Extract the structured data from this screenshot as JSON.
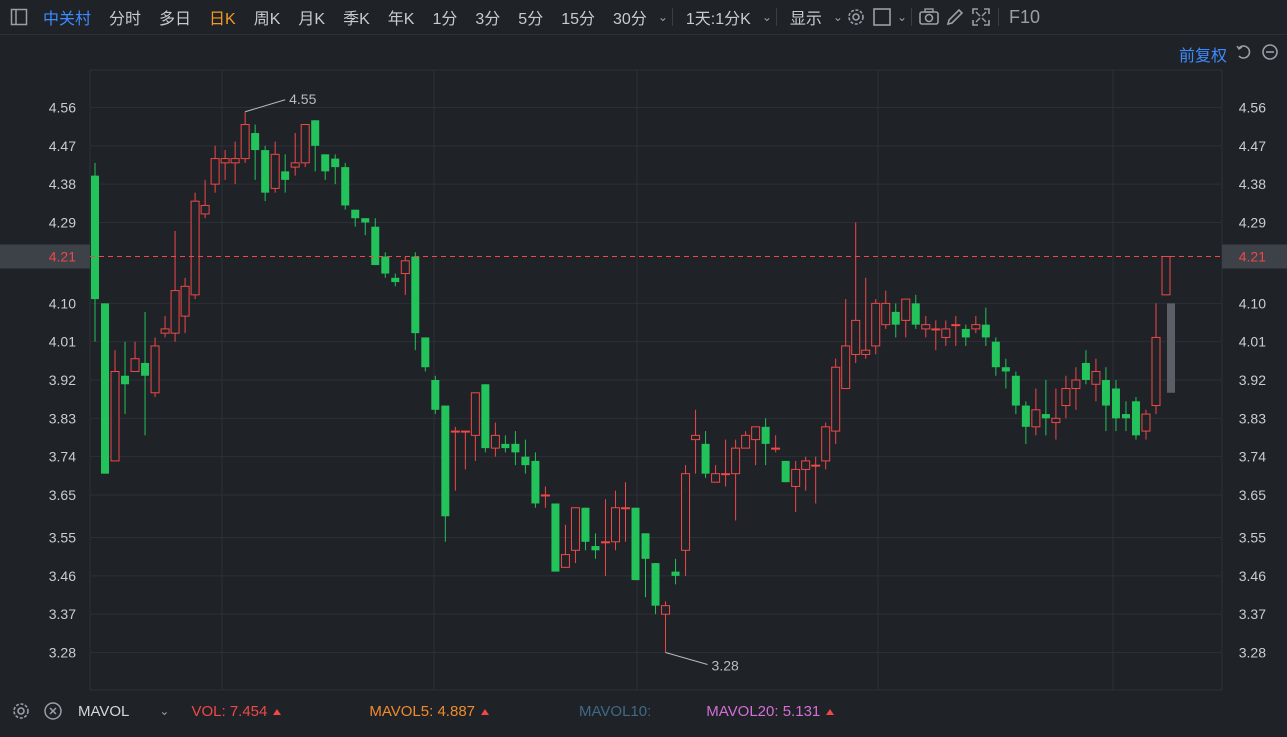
{
  "toolbar": {
    "stock_name": "中关村",
    "periods": [
      "分时",
      "多日",
      "日K",
      "周K",
      "月K",
      "季K",
      "年K",
      "1分",
      "3分",
      "5分",
      "15分",
      "30分"
    ],
    "active_period": "日K",
    "range_select": "1天:1分K",
    "display_label": "显示",
    "f10_label": "F10"
  },
  "adjust_label": "前复权",
  "price_axis": {
    "ticks": [
      "4.56",
      "4.47",
      "4.38",
      "4.29",
      "4.10",
      "4.01",
      "3.92",
      "3.83",
      "3.74",
      "3.65",
      "3.55",
      "3.46",
      "3.37",
      "3.28"
    ],
    "current": "4.21"
  },
  "markers": {
    "high": "4.55",
    "low": "3.28"
  },
  "indicator_bar": {
    "name": "MAVOL",
    "vol_label": "VOL:",
    "vol_value": "7.454",
    "mavol5_label": "MAVOL5:",
    "mavol5_value": "4.887",
    "mavol10_label": "MAVOL10:",
    "mavol20_label": "MAVOL20:",
    "mavol20_value": "5.131"
  },
  "colors": {
    "up": "#f04848",
    "down": "#22c35a",
    "grid": "#2c3036",
    "bg": "#1f2227",
    "vol": "#f04848",
    "mavol5": "#f08a2c",
    "mavol10": "#3f6a86",
    "mavol20": "#d36fd6",
    "accent": "#3d8bff"
  },
  "chart_data": {
    "type": "candlestick",
    "ylim": [
      3.26,
      4.58
    ],
    "current_price": 4.21,
    "high_mark": 4.55,
    "low_mark": 3.28,
    "candles": [
      [
        4.4,
        4.11,
        4.43,
        4.01
      ],
      [
        4.1,
        3.7,
        4.1,
        3.7
      ],
      [
        3.73,
        3.94,
        3.99,
        3.73
      ],
      [
        3.93,
        3.91,
        4.01,
        3.84
      ],
      [
        3.94,
        3.97,
        4.01,
        3.94
      ],
      [
        3.96,
        3.93,
        4.08,
        3.79
      ],
      [
        3.89,
        4.0,
        4.02,
        3.88
      ],
      [
        4.03,
        4.04,
        4.07,
        4.02
      ],
      [
        4.03,
        4.13,
        4.27,
        4.01
      ],
      [
        4.07,
        4.14,
        4.16,
        4.03
      ],
      [
        4.12,
        4.34,
        4.36,
        4.11
      ],
      [
        4.31,
        4.33,
        4.39,
        4.3
      ],
      [
        4.38,
        4.44,
        4.47,
        4.36
      ],
      [
        4.43,
        4.44,
        4.46,
        4.39
      ],
      [
        4.43,
        4.44,
        4.48,
        4.38
      ],
      [
        4.44,
        4.52,
        4.55,
        4.43
      ],
      [
        4.5,
        4.46,
        4.52,
        4.39
      ],
      [
        4.46,
        4.36,
        4.47,
        4.34
      ],
      [
        4.37,
        4.45,
        4.48,
        4.36
      ],
      [
        4.41,
        4.39,
        4.45,
        4.36
      ],
      [
        4.42,
        4.43,
        4.5,
        4.4
      ],
      [
        4.43,
        4.52,
        4.52,
        4.42
      ],
      [
        4.53,
        4.47,
        4.53,
        4.41
      ],
      [
        4.45,
        4.41,
        4.45,
        4.39
      ],
      [
        4.44,
        4.42,
        4.45,
        4.38
      ],
      [
        4.42,
        4.33,
        4.43,
        4.32
      ],
      [
        4.32,
        4.3,
        4.32,
        4.28
      ],
      [
        4.3,
        4.29,
        4.3,
        4.26
      ],
      [
        4.28,
        4.19,
        4.3,
        4.19
      ],
      [
        4.21,
        4.17,
        4.22,
        4.16
      ],
      [
        4.16,
        4.15,
        4.17,
        4.14
      ],
      [
        4.17,
        4.2,
        4.21,
        4.12
      ],
      [
        4.21,
        4.03,
        4.22,
        3.99
      ],
      [
        4.02,
        3.95,
        4.02,
        3.94
      ],
      [
        3.92,
        3.85,
        3.93,
        3.84
      ],
      [
        3.86,
        3.6,
        3.86,
        3.54
      ],
      [
        3.8,
        3.8,
        3.81,
        3.66
      ],
      [
        3.8,
        3.8,
        3.8,
        3.71
      ],
      [
        3.79,
        3.89,
        3.89,
        3.73
      ],
      [
        3.91,
        3.76,
        3.91,
        3.75
      ],
      [
        3.76,
        3.79,
        3.82,
        3.74
      ],
      [
        3.77,
        3.76,
        3.79,
        3.75
      ],
      [
        3.77,
        3.75,
        3.8,
        3.72
      ],
      [
        3.74,
        3.72,
        3.78,
        3.7
      ],
      [
        3.73,
        3.63,
        3.75,
        3.62
      ],
      [
        3.65,
        3.65,
        3.67,
        3.62
      ],
      [
        3.63,
        3.47,
        3.63,
        3.47
      ],
      [
        3.48,
        3.51,
        3.58,
        3.48
      ],
      [
        3.52,
        3.62,
        3.62,
        3.49
      ],
      [
        3.62,
        3.54,
        3.62,
        3.52
      ],
      [
        3.53,
        3.52,
        3.56,
        3.5
      ],
      [
        3.54,
        3.54,
        3.64,
        3.46
      ],
      [
        3.54,
        3.62,
        3.66,
        3.52
      ],
      [
        3.62,
        3.62,
        3.68,
        3.54
      ],
      [
        3.62,
        3.45,
        3.62,
        3.45
      ],
      [
        3.56,
        3.5,
        3.56,
        3.41
      ],
      [
        3.49,
        3.39,
        3.49,
        3.37
      ],
      [
        3.37,
        3.39,
        3.4,
        3.28
      ],
      [
        3.47,
        3.46,
        3.5,
        3.44
      ],
      [
        3.52,
        3.7,
        3.72,
        3.46
      ],
      [
        3.78,
        3.79,
        3.85,
        3.7
      ],
      [
        3.77,
        3.7,
        3.8,
        3.69
      ],
      [
        3.68,
        3.7,
        3.72,
        3.68
      ],
      [
        3.7,
        3.7,
        3.78,
        3.67
      ],
      [
        3.7,
        3.76,
        3.78,
        3.59
      ],
      [
        3.76,
        3.79,
        3.8,
        3.76
      ],
      [
        3.78,
        3.81,
        3.81,
        3.72
      ],
      [
        3.81,
        3.77,
        3.83,
        3.72
      ],
      [
        3.76,
        3.76,
        3.79,
        3.75
      ],
      [
        3.73,
        3.68,
        3.73,
        3.68
      ],
      [
        3.67,
        3.71,
        3.73,
        3.61
      ],
      [
        3.71,
        3.73,
        3.74,
        3.66
      ],
      [
        3.72,
        3.72,
        3.74,
        3.63
      ],
      [
        3.73,
        3.81,
        3.82,
        3.71
      ],
      [
        3.8,
        3.95,
        3.97,
        3.77
      ],
      [
        3.9,
        4.0,
        4.11,
        3.92
      ],
      [
        3.98,
        4.06,
        4.29,
        3.96
      ],
      [
        3.98,
        3.99,
        4.16,
        3.97
      ],
      [
        4.0,
        4.1,
        4.11,
        3.98
      ],
      [
        4.05,
        4.1,
        4.13,
        4.04
      ],
      [
        4.08,
        4.05,
        4.1,
        4.02
      ],
      [
        4.06,
        4.11,
        4.11,
        4.02
      ],
      [
        4.1,
        4.05,
        4.12,
        4.04
      ],
      [
        4.04,
        4.05,
        4.07,
        4.02
      ],
      [
        4.04,
        4.04,
        4.06,
        3.99
      ],
      [
        4.02,
        4.04,
        4.06,
        4.0
      ],
      [
        4.05,
        4.05,
        4.07,
        4.0
      ],
      [
        4.04,
        4.02,
        4.05,
        4.0
      ],
      [
        4.04,
        4.05,
        4.07,
        4.03
      ],
      [
        4.05,
        4.02,
        4.09,
        4.0
      ],
      [
        4.01,
        3.95,
        4.02,
        3.93
      ],
      [
        3.95,
        3.94,
        3.97,
        3.9
      ],
      [
        3.93,
        3.86,
        3.94,
        3.84
      ],
      [
        3.86,
        3.81,
        3.87,
        3.77
      ],
      [
        3.81,
        3.85,
        3.9,
        3.79
      ],
      [
        3.84,
        3.83,
        3.92,
        3.79
      ],
      [
        3.82,
        3.83,
        3.9,
        3.78
      ],
      [
        3.86,
        3.9,
        3.93,
        3.83
      ],
      [
        3.9,
        3.92,
        3.95,
        3.85
      ],
      [
        3.96,
        3.92,
        3.99,
        3.91
      ],
      [
        3.91,
        3.94,
        3.97,
        3.87
      ],
      [
        3.92,
        3.86,
        3.95,
        3.8
      ],
      [
        3.9,
        3.83,
        3.92,
        3.8
      ],
      [
        3.84,
        3.83,
        3.87,
        3.8
      ],
      [
        3.87,
        3.79,
        3.88,
        3.78
      ],
      [
        3.8,
        3.84,
        3.85,
        3.78
      ],
      [
        3.86,
        4.02,
        4.1,
        3.84
      ],
      [
        4.12,
        4.21,
        4.21,
        4.12
      ]
    ]
  }
}
